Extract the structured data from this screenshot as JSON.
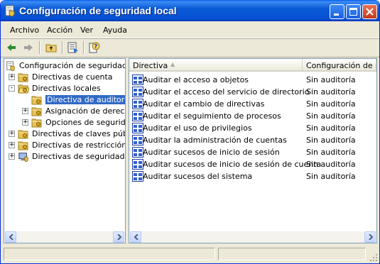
{
  "window": {
    "title": "Configuración de seguridad local"
  },
  "menu": [
    "Archivo",
    "Acción",
    "Ver",
    "Ayuda"
  ],
  "tree": [
    {
      "label": "Configuración de seguridad",
      "level": 0,
      "expander": "",
      "icon": "security-settings-icon",
      "selected": false
    },
    {
      "label": "Directivas de cuenta",
      "level": 1,
      "expander": "+",
      "icon": "folder-icon",
      "selected": false
    },
    {
      "label": "Directivas locales",
      "level": 1,
      "expander": "-",
      "icon": "open-folder-icon",
      "selected": false
    },
    {
      "label": "Directiva de auditoría",
      "level": 2,
      "expander": "",
      "icon": "folder-icon",
      "selected": true
    },
    {
      "label": "Asignación de derechos",
      "level": 2,
      "expander": "+",
      "icon": "folder-icon",
      "selected": false
    },
    {
      "label": "Opciones de seguridad",
      "level": 2,
      "expander": "+",
      "icon": "folder-icon",
      "selected": false
    },
    {
      "label": "Directivas de claves públicas",
      "level": 1,
      "expander": "+",
      "icon": "folder-icon",
      "selected": false
    },
    {
      "label": "Directivas de restricción de software",
      "level": 1,
      "expander": "+",
      "icon": "folder-icon",
      "selected": false
    },
    {
      "label": "Directivas de seguridad IP",
      "level": 1,
      "expander": "+",
      "icon": "computer-security-icon",
      "selected": false
    }
  ],
  "list": {
    "columns": [
      "Directiva",
      "Configuración de se..."
    ],
    "sort_indicator": "▲",
    "rows": [
      {
        "name": "Auditar el acceso a objetos",
        "value": "Sin auditoría"
      },
      {
        "name": "Auditar el acceso del servicio de directorio",
        "value": "Sin auditoría"
      },
      {
        "name": "Auditar el cambio de directivas",
        "value": "Sin auditoría"
      },
      {
        "name": "Auditar el seguimiento de procesos",
        "value": "Sin auditoría"
      },
      {
        "name": "Auditar el uso de privilegios",
        "value": "Sin auditoría"
      },
      {
        "name": "Auditar la administración de cuentas",
        "value": "Sin auditoría"
      },
      {
        "name": "Auditar sucesos de inicio de sesión",
        "value": "Sin auditoría"
      },
      {
        "name": "Auditar sucesos de inicio de sesión de cuenta",
        "value": "Sin auditoría"
      },
      {
        "name": "Auditar sucesos del sistema",
        "value": "Sin auditoría"
      }
    ]
  },
  "colors": {
    "titlebar": "#0a5ad6",
    "selection": "#316ac5",
    "window_bg": "#ece9d8",
    "folder": "#f2d16b"
  }
}
